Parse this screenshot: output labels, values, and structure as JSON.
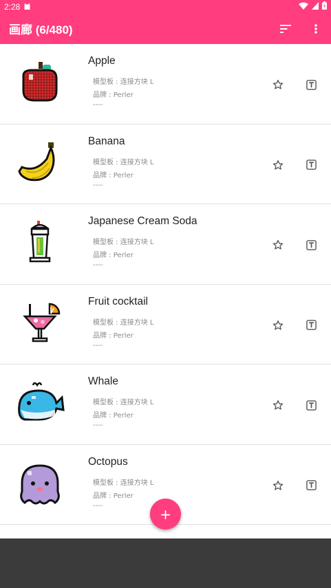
{
  "status_bar": {
    "time": "2:28"
  },
  "app_bar": {
    "title": "画廊 (6/480)",
    "sort_icon": "sort-icon",
    "more_icon": "more-vert-icon"
  },
  "colors": {
    "accent": "#ff3d7f",
    "divider": "#e0e0e0",
    "meta_text": "#8a8a8a",
    "title_text": "#212121"
  },
  "items": [
    {
      "name": "Apple",
      "board": "模型板 : 连接方块 L",
      "brand": "品牌 : Perler",
      "extra": "----",
      "art": "apple-pixel-art"
    },
    {
      "name": "Banana",
      "board": "模型板 : 连接方块 L",
      "brand": "品牌 : Perler",
      "extra": "----",
      "art": "banana-pixel-art"
    },
    {
      "name": "Japanese Cream Soda",
      "board": "模型板 : 连接方块 L",
      "brand": "品牌 : Perler",
      "extra": "----",
      "art": "cream-soda-pixel-art"
    },
    {
      "name": "Fruit cocktail",
      "board": "模型板 : 连接方块 L",
      "brand": "品牌 : Perler",
      "extra": "----",
      "art": "fruit-cocktail-pixel-art"
    },
    {
      "name": "Whale",
      "board": "模型板 : 连接方块 L",
      "brand": "品牌 : Perler",
      "extra": "----",
      "art": "whale-pixel-art"
    },
    {
      "name": "Octopus",
      "board": "模型板 : 连接方块 L",
      "brand": "品牌 : Perler",
      "extra": "----",
      "art": "octopus-pixel-art"
    }
  ],
  "fab": {
    "label": "+"
  }
}
